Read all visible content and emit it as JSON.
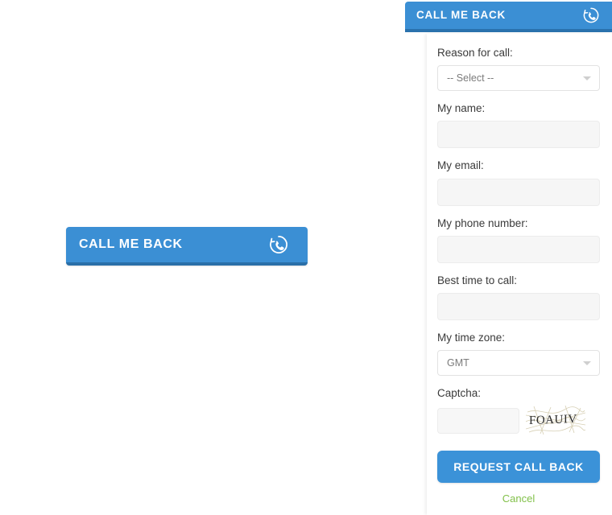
{
  "trigger": {
    "label": "CALL ME BACK",
    "icon": "phone-callback-icon",
    "bg_color": "#3b8fd4",
    "edge_color": "#2a6fa8"
  },
  "panel": {
    "header": {
      "title": "CALL ME BACK",
      "icon": "phone-callback-icon",
      "bg_color": "#3b8fd4",
      "edge_color": "#2a72ad"
    },
    "fields": [
      {
        "name": "reason-for-call",
        "label": "Reason for call:",
        "type": "select",
        "value": "-- Select --",
        "placeholder": ""
      },
      {
        "name": "my-name",
        "label": "My name:",
        "type": "text",
        "value": "",
        "placeholder": ""
      },
      {
        "name": "my-email",
        "label": "My email:",
        "type": "text",
        "value": "",
        "placeholder": ""
      },
      {
        "name": "my-phone-number",
        "label": "My phone number:",
        "type": "text",
        "value": "",
        "placeholder": ""
      },
      {
        "name": "best-time-to-call",
        "label": "Best time to call:",
        "type": "text",
        "value": "",
        "placeholder": ""
      },
      {
        "name": "my-time-zone",
        "label": "My time zone:",
        "type": "select",
        "value": "GMT",
        "placeholder": ""
      }
    ],
    "captcha": {
      "label": "Captcha:",
      "value": "",
      "placeholder": "",
      "challenge_text": "FOAUIV"
    },
    "submit": {
      "label": "REQUEST CALL BACK",
      "color": "#3b92d8"
    },
    "cancel": {
      "label": "Cancel",
      "color": "#82c14a"
    }
  }
}
